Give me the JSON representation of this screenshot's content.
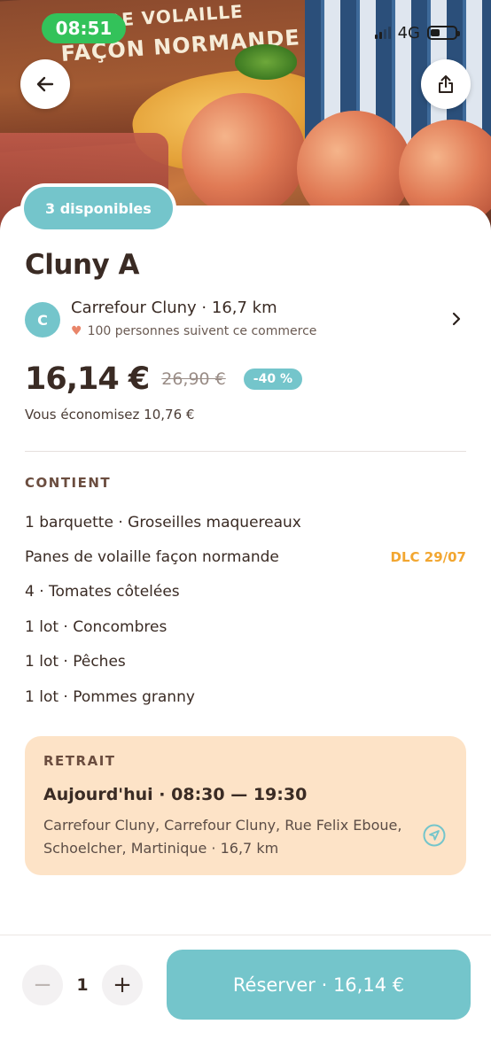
{
  "status_bar": {
    "time": "08:51",
    "network": "4G"
  },
  "hero": {
    "package_text_line1": "S DE VOLAILLE",
    "package_text_line2": "FAÇON NORMANDE"
  },
  "badge": {
    "availability": "3 disponibles"
  },
  "offer": {
    "title": "Cluny A",
    "store": {
      "initial": "C",
      "name": "Carrefour Cluny",
      "distance": "16,7 km",
      "followers": "100 personnes suivent ce commerce"
    },
    "price": {
      "current": "16,14 €",
      "original": "26,90 €",
      "discount": "-40 %",
      "savings": "Vous économisez 10,76 €"
    }
  },
  "contents": {
    "label": "CONTIENT",
    "items": [
      {
        "text": "1 barquette · Groseilles maquereaux",
        "tag": ""
      },
      {
        "text": "Panes de volaille façon normande",
        "tag": "DLC 29/07"
      },
      {
        "text": "4 · Tomates côtelées",
        "tag": ""
      },
      {
        "text": "1 lot · Concombres",
        "tag": ""
      },
      {
        "text": "1 lot · Pêches",
        "tag": ""
      },
      {
        "text": "1 lot · Pommes granny",
        "tag": ""
      }
    ]
  },
  "pickup": {
    "label": "RETRAIT",
    "time": "Aujourd'hui · 08:30 — 19:30",
    "address": "Carrefour Cluny, Carrefour Cluny, Rue Felix Eboue, Schoelcher, Martinique",
    "distance": "16,7 km"
  },
  "footer": {
    "quantity": "1",
    "minus": "−",
    "plus": "+",
    "reserve_label": "Réserver · 16,14 €"
  },
  "colors": {
    "accent": "#74c5cb",
    "dlc": "#f2a630",
    "pickup_bg": "#fde3c7",
    "text": "#3a2b24",
    "status_time_bg": "#33c25a"
  },
  "icons": [
    "back-arrow-icon",
    "share-icon",
    "chevron-right-icon",
    "heart-icon",
    "navigation-arrow-icon"
  ]
}
